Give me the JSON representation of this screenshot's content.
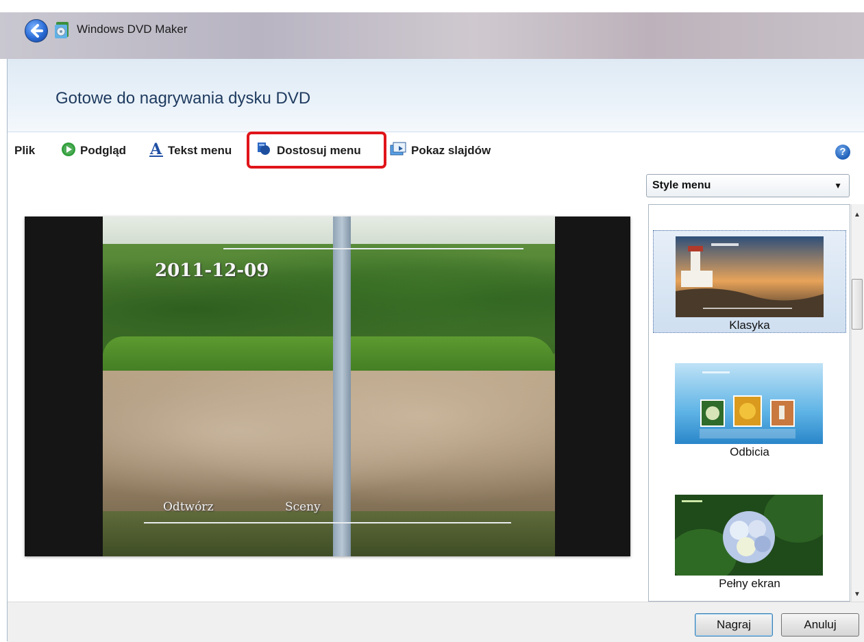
{
  "window": {
    "title": "Windows DVD Maker",
    "header": "Gotowe do nagrywania dysku DVD"
  },
  "toolbar": {
    "file": "Plik",
    "preview": "Podgląd",
    "menu_text": "Tekst menu",
    "customize_menu": "Dostosuj menu",
    "slideshow": "Pokaz slajdów",
    "highlight_color": "#e0151a"
  },
  "preview": {
    "date": "2011-12-09",
    "play": "Odtwórz",
    "scenes": "Sceny"
  },
  "styles": {
    "dropdown_value": "Style menu",
    "items": [
      {
        "label": "Klasyka",
        "selected": true
      },
      {
        "label": "Odbicia",
        "selected": false
      },
      {
        "label": "Pełny ekran",
        "selected": false
      }
    ]
  },
  "footer": {
    "burn": "Nagraj",
    "cancel": "Anuluj"
  },
  "icons": [
    "back-arrow-icon",
    "dvd-maker-icon",
    "play-icon",
    "text-a-icon",
    "customize-menu-icon",
    "slideshow-icon",
    "help-icon"
  ]
}
